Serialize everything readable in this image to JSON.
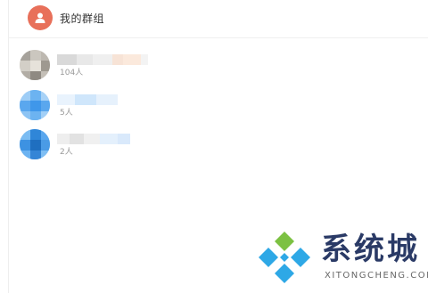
{
  "header": {
    "title": "我的群组",
    "icon": "group-user-icon",
    "icon_color": "#e8705a"
  },
  "groups": [
    {
      "member_count": "104人",
      "avatar": "photo-avatar"
    },
    {
      "member_count": "5人",
      "avatar": "blue-default-avatar"
    },
    {
      "member_count": "2人",
      "avatar": "blue-photo-avatar"
    }
  ],
  "watermark": {
    "text": "系统城",
    "url": "XITONGCHENG.COM",
    "text_color": "#2a3a66",
    "diamond_colors": [
      "#7cc142",
      "#2ea8e6"
    ]
  }
}
